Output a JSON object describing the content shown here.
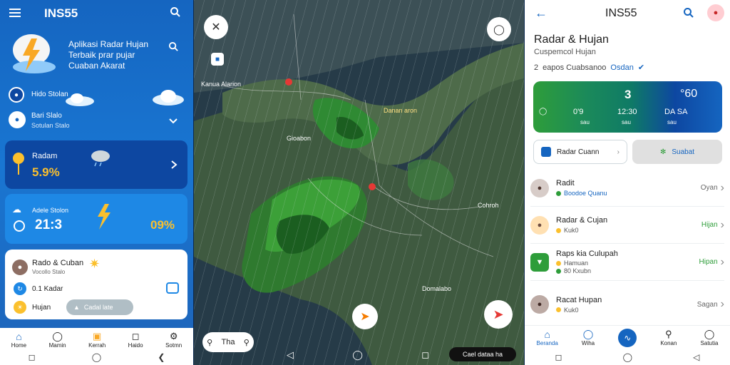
{
  "left": {
    "app_title": "INS55",
    "hero": {
      "line1": "Aplikasi Radar Hujan",
      "line2": "Terbaik prar pujar",
      "line3": "Cuaban Akarat"
    },
    "row1_label": "Hido Stolan",
    "row2_label1": "Bari Slalo",
    "row2_label2": "Sotulan Stalo",
    "card1": {
      "title": "Radam",
      "value": "5.9%"
    },
    "card2": {
      "title": "Adele Stolon",
      "value": "21:3",
      "percent": "09%"
    },
    "card3": {
      "title": "Rado & Cuban",
      "subtitle": "Vocollo Stalo",
      "item_label": "0.1 Kadar",
      "chip1": "Hujan",
      "chip2": "Cadal late"
    },
    "nav": [
      "Home",
      "Mamin",
      "Kerrah",
      "Haido",
      "Sotmn"
    ]
  },
  "map": {
    "labels": {
      "city1": "Kanua Alarion",
      "city2": "Danan aron",
      "city3": "Gioabon",
      "city4": "Cohroh",
      "city5": "Domalabo"
    },
    "search_label": "Tha",
    "legend_label": "Cael dataa ha"
  },
  "right": {
    "app_title": "INS55",
    "page_title": "Radar & Hujan",
    "subtitle": "Cuspemcol Hujan",
    "meta_prefix": "2",
    "meta_text": "eapos Cuabsanoo",
    "meta_tag": "Osdan",
    "stats": {
      "val_top1": "3",
      "val_top2": "°60",
      "val_a": "0'9",
      "val_b": "12:30",
      "val_c": "DA SA",
      "lbl_b": "sau",
      "lbl_c": "sau",
      "lbl_d": "sau"
    },
    "btn_radar": "Radar Cuann",
    "btn_submit": "Suabat",
    "list": [
      {
        "title": "Radit",
        "sub": "Boodoe Quanu",
        "action": "Oyan",
        "action_color": "#666666"
      },
      {
        "title": "Radar & Cujan",
        "sub": "Kuk0",
        "action": "Hijan",
        "action_color": "#2e9d3a"
      },
      {
        "title": "Raps kia Culupah",
        "sub": "Hamuan",
        "sub2": "80 Kxubn",
        "action": "Hipan",
        "action_color": "#2e9d3a"
      },
      {
        "title": "Racat Hupan",
        "sub": "Kuk0",
        "action": "Sagan",
        "action_color": "#666666"
      }
    ],
    "nav": [
      "Beranda",
      "Wiha",
      "",
      "Konan",
      "Satutia"
    ]
  },
  "colors": {
    "blue": "#1976d2",
    "green": "#2e9d3a",
    "dark": "#0d47a1"
  }
}
